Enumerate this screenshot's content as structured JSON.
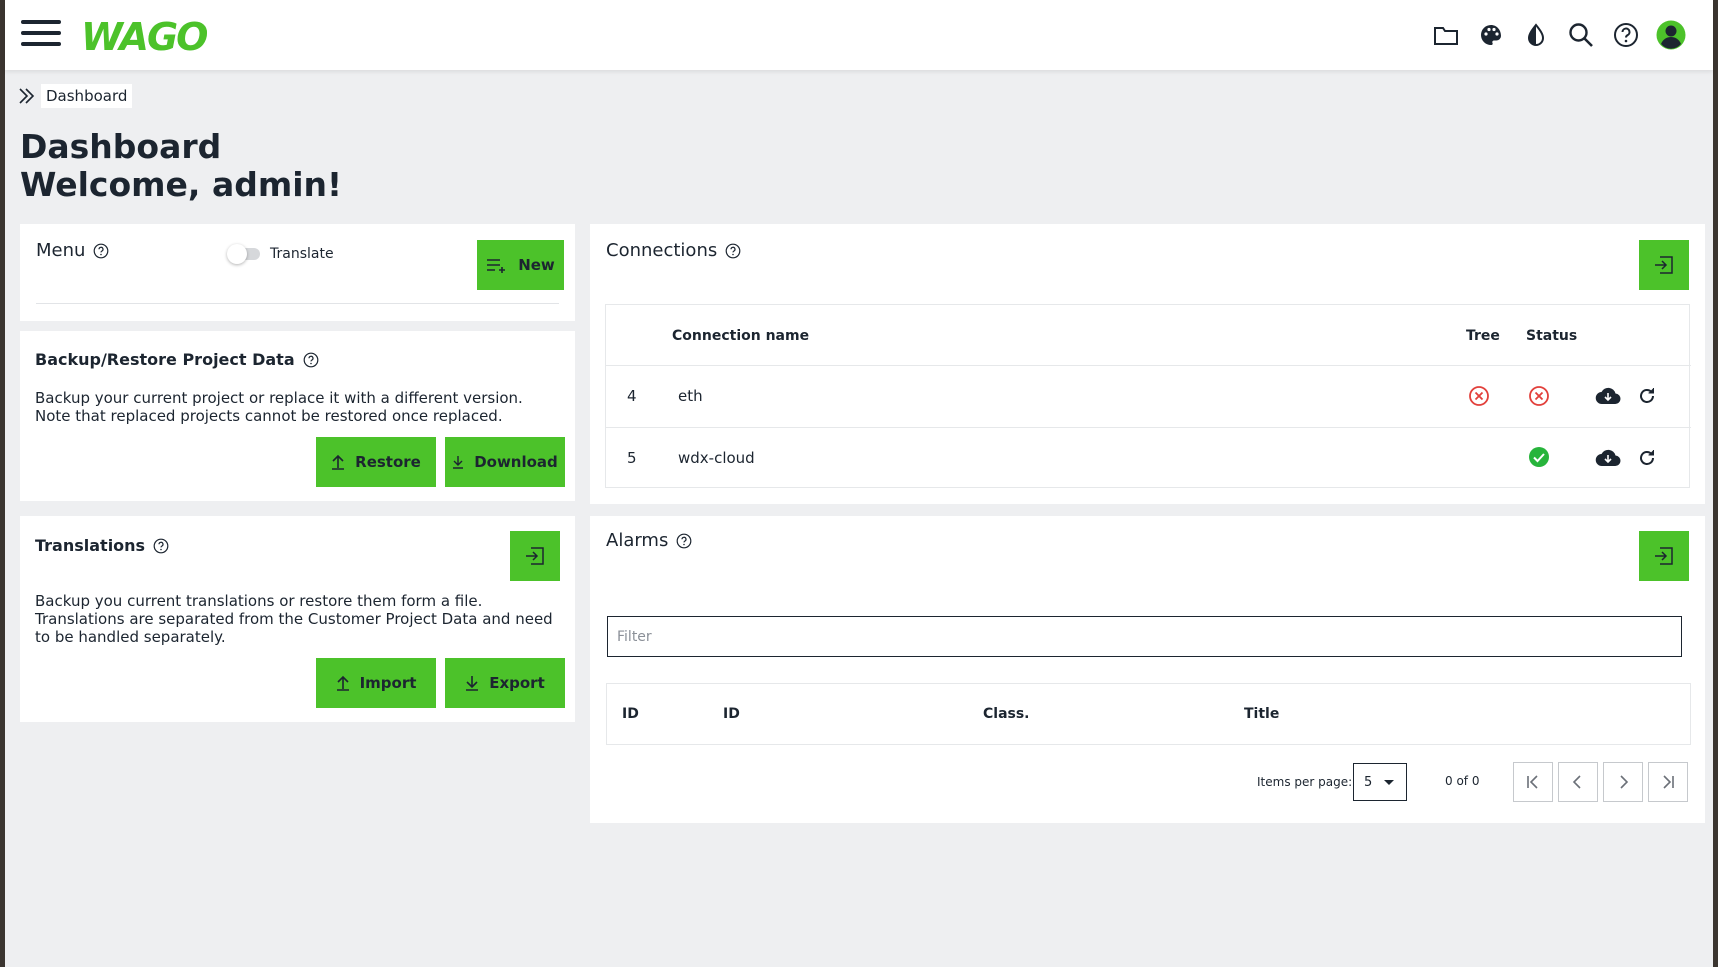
{
  "header": {
    "logo_text": "WAGO",
    "icons": [
      "folder-icon",
      "palette-icon",
      "contrast-icon",
      "search-icon",
      "help-icon",
      "account-icon"
    ]
  },
  "breadcrumb": {
    "current": "Dashboard"
  },
  "page": {
    "title_line1": "Dashboard",
    "title_line2": "Welcome, admin!"
  },
  "menu_card": {
    "title": "Menu",
    "toggle_label": "Translate",
    "new_label": "New"
  },
  "backup_card": {
    "title": "Backup/Restore Project Data",
    "description": "Backup your current project or replace it with a different version. Note that replaced projects cannot be restored once replaced.",
    "restore_label": "Restore",
    "download_label": "Download"
  },
  "translations_card": {
    "title": "Translations",
    "description": "Backup you current translations or restore them form a file. Translations are separated from the Customer Project Data and need to be handled separately.",
    "import_label": "Import",
    "export_label": "Export"
  },
  "connections_card": {
    "title": "Connections",
    "columns": {
      "name": "Connection name",
      "tree": "Tree",
      "status": "Status"
    },
    "rows": [
      {
        "id": "4",
        "name": "eth",
        "tree": "error",
        "status": "error"
      },
      {
        "id": "5",
        "name": "wdx-cloud",
        "tree": "",
        "status": "ok"
      }
    ]
  },
  "alarms_card": {
    "title": "Alarms",
    "filter_placeholder": "Filter",
    "columns": {
      "id1": "ID",
      "id2": "ID",
      "class": "Class.",
      "title": "Title"
    },
    "items_per_page_label": "Items per page:",
    "items_per_page": "5",
    "range": "0 of 0"
  },
  "colors": {
    "accent": "#4cc22a",
    "text": "#1c2530",
    "error": "#e2403b",
    "ok": "#27b43b"
  }
}
